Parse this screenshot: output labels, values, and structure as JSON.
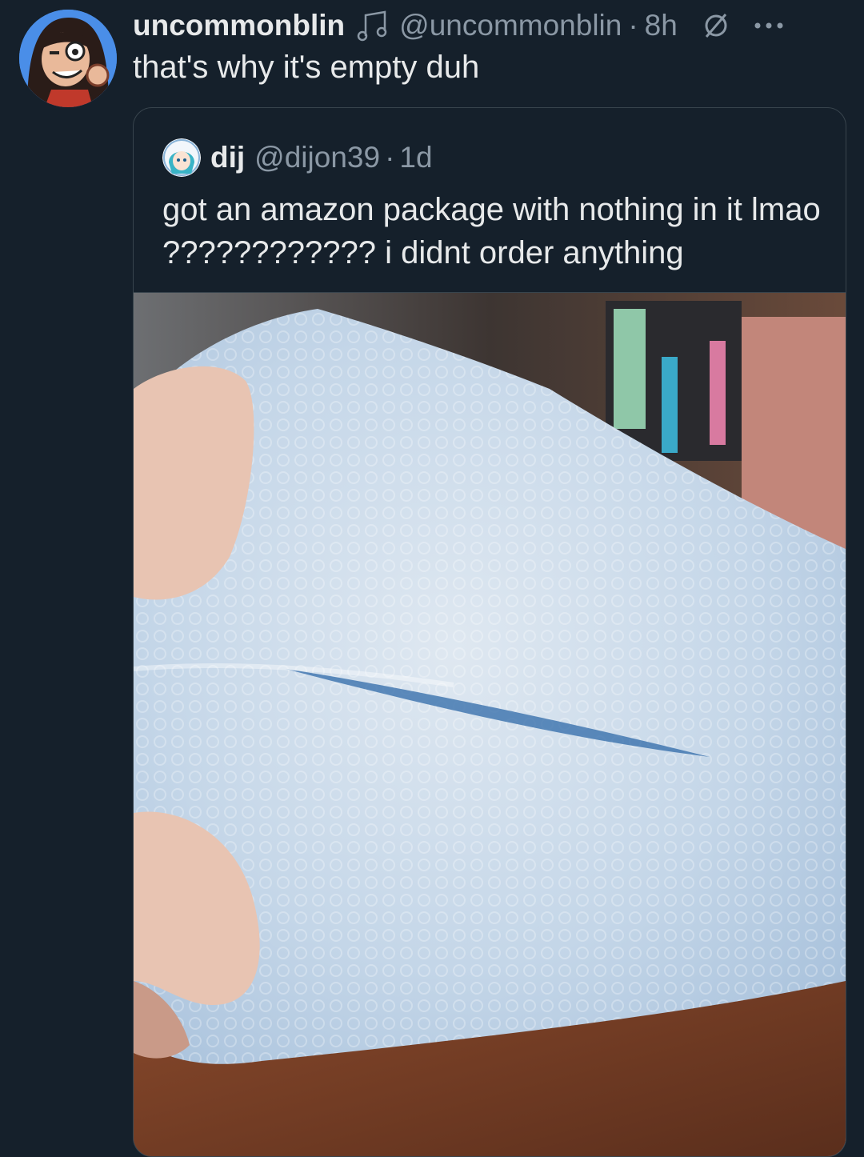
{
  "tweet": {
    "display_name": "uncommonblin",
    "music_icon": "music-note-icon",
    "handle": "@uncommonblin",
    "separator": "·",
    "time": "8h",
    "null_icon": "null-symbol-icon",
    "more_icon": "ellipsis-icon",
    "text": "that's why it's empty duh"
  },
  "quote": {
    "display_name": "dij",
    "handle": "@dijon39",
    "separator": "·",
    "time": "1d",
    "text": "got an amazon package with nothing in it lmao ???????????? i didnt order anything",
    "media_subject": "empty bubble mailer held open"
  },
  "colors": {
    "background": "#15202b",
    "text_primary": "#e7e9ea",
    "text_secondary": "#8b98a5",
    "border": "#38444d"
  }
}
